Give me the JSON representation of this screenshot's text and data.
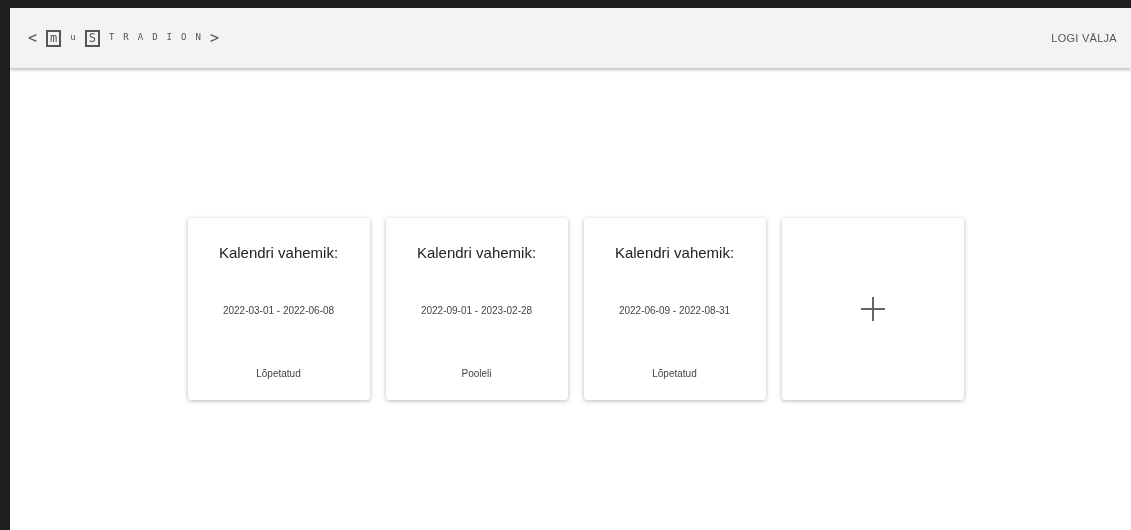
{
  "header": {
    "logo": {
      "prev": "<",
      "letters": [
        {
          "char": "m",
          "boxed": true
        },
        {
          "char": "u",
          "boxed": false
        },
        {
          "char": "S",
          "boxed": true
        },
        {
          "char": "T",
          "boxed": false
        },
        {
          "char": "R",
          "boxed": false
        },
        {
          "char": "A",
          "boxed": false
        },
        {
          "char": "D",
          "boxed": false
        },
        {
          "char": "I",
          "boxed": false
        },
        {
          "char": "O",
          "boxed": false
        },
        {
          "char": "N",
          "boxed": false
        }
      ],
      "next": ">"
    },
    "logout": "LOGI VÄLJA"
  },
  "cards": [
    {
      "kind": "period",
      "title": "Kalendri vahemik:",
      "range": "2022-03-01 - 2022-06-08",
      "status": "Lõpetatud"
    },
    {
      "kind": "period",
      "title": "Kalendri vahemik:",
      "range": "2022-09-01 - 2023-02-28",
      "status": "Pooleli"
    },
    {
      "kind": "period",
      "title": "Kalendri vahemik:",
      "range": "2022-06-09 - 2022-08-31",
      "status": "Lõpetatud"
    },
    {
      "kind": "add"
    }
  ]
}
